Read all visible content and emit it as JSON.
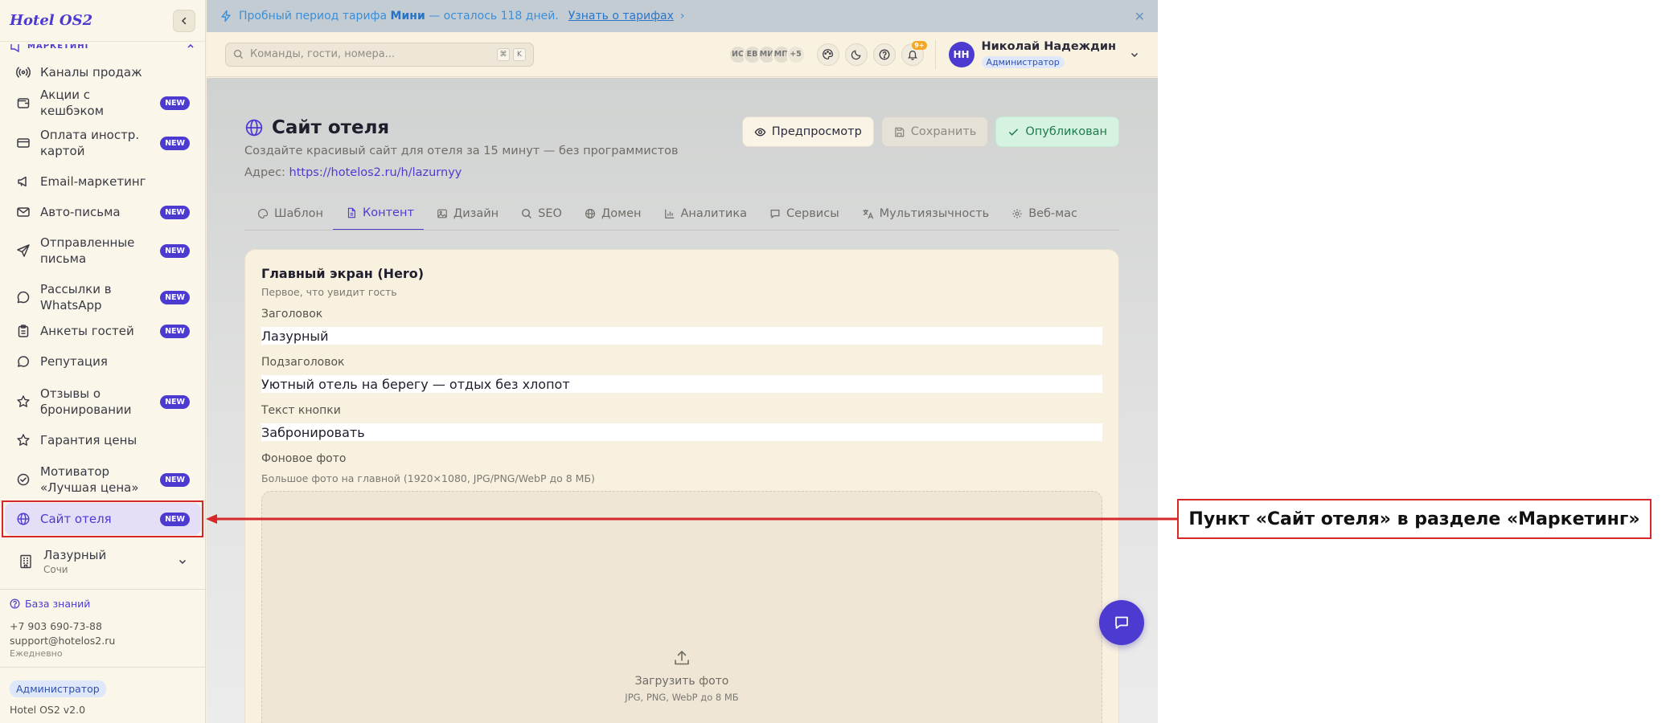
{
  "app": {
    "logo": "Hotel OS2"
  },
  "sidebar": {
    "section_label": "МАРКЕТИНГ",
    "items": [
      {
        "label": "Каналы продаж",
        "icon": "radio-icon",
        "badge": ""
      },
      {
        "label": "Акции с кешбэком",
        "icon": "wallet-icon",
        "badge": "NEW"
      },
      {
        "label": "Оплата иностр. картой",
        "icon": "card-icon",
        "badge": "NEW"
      },
      {
        "label": "Email-маркетинг",
        "icon": "megaphone-icon",
        "badge": ""
      },
      {
        "label": "Авто-письма",
        "icon": "mail-icon",
        "badge": "NEW"
      },
      {
        "label": "Отправленные письма",
        "icon": "send-icon",
        "badge": "NEW"
      },
      {
        "label": "Рассылки в WhatsApp",
        "icon": "chat-icon",
        "badge": "NEW"
      },
      {
        "label": "Анкеты гостей",
        "icon": "clipboard-icon",
        "badge": "NEW"
      },
      {
        "label": "Репутация",
        "icon": "message-icon",
        "badge": ""
      },
      {
        "label": "Отзывы о бронировании",
        "icon": "star-icon",
        "badge": "NEW"
      },
      {
        "label": "Гарантия цены",
        "icon": "star-icon",
        "badge": ""
      },
      {
        "label": "Мотиватор «Лучшая цена»",
        "icon": "badge-check-icon",
        "badge": "NEW"
      },
      {
        "label": "Сайт отеля",
        "icon": "globe-icon",
        "badge": "NEW",
        "active": true
      }
    ],
    "hotel": {
      "name": "Лазурный",
      "city": "Сочи"
    },
    "knowledge_base": "База знаний",
    "phone": "+7 903 690-73-88",
    "email": "support@hotelos2.ru",
    "hours": "Ежедневно",
    "role": "Администратор",
    "version": "Hotel OS2 v2.0"
  },
  "banner": {
    "prefix": "Пробный период тарифа",
    "plan": "Мини",
    "suffix": "— осталось 118 дней.",
    "link": "Узнать о тарифах",
    "link_chevron": "›",
    "close": "✕"
  },
  "topbar": {
    "search_placeholder": "Команды, гости, номера...",
    "shortcut_keys": [
      "⌘",
      "K"
    ],
    "avatars": [
      "ИС",
      "ЕВ",
      "МИ",
      "МП",
      "+5"
    ],
    "notifications_count": "9+",
    "user": {
      "initials": "НН",
      "name": "Николай Надеждин",
      "role": "Администратор"
    }
  },
  "page": {
    "title": "Сайт отеля",
    "subtitle": "Создайте красивый сайт для отеля за 15 минут — без программистов",
    "address_label": "Адрес:",
    "address_url": "https://hotelos2.ru/h/lazurnyy",
    "actions": {
      "preview": "Предпросмотр",
      "save": "Сохранить",
      "published": "Опубликован"
    },
    "tabs": [
      {
        "label": "Шаблон",
        "icon": "palette-icon"
      },
      {
        "label": "Контент",
        "icon": "file-icon",
        "active": true
      },
      {
        "label": "Дизайн",
        "icon": "image-icon"
      },
      {
        "label": "SEO",
        "icon": "search-icon"
      },
      {
        "label": "Домен",
        "icon": "globe-icon"
      },
      {
        "label": "Аналитика",
        "icon": "bar-chart-icon"
      },
      {
        "label": "Сервисы",
        "icon": "message-icon"
      },
      {
        "label": "Мультиязычность",
        "icon": "translate-icon"
      },
      {
        "label": "Веб-мас",
        "icon": "gear-icon"
      }
    ]
  },
  "hero": {
    "title": "Главный экран (Hero)",
    "subtitle": "Первое, что увидит гость",
    "heading_label": "Заголовок",
    "heading_value": "Лазурный",
    "subheading_label": "Подзаголовок",
    "subheading_value": "Уютный отель на берегу — отдых без хлопот",
    "button_label": "Текст кнопки",
    "button_value": "Забронировать",
    "photo_label": "Фоновое фото",
    "photo_hint": "Большое фото на главной (1920×1080, JPG/PNG/WebP до 8 МБ)",
    "upload_text": "Загрузить фото",
    "upload_hint": "JPG, PNG, WebP до 8 МБ"
  },
  "annotation": {
    "label": "Пункт «Сайт отеля» в разделе «Маркетинг»",
    "color": "#d62828"
  },
  "colors": {
    "accent": "#4d3bd1",
    "success": "#1f7a4a",
    "banner": "#3b8fd9"
  }
}
